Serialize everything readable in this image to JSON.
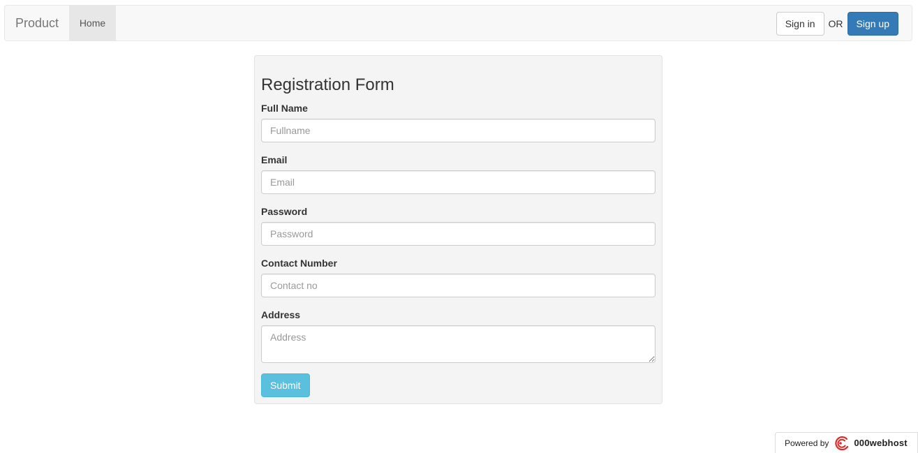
{
  "navbar": {
    "brand": "Product",
    "home_label": "Home",
    "sign_in_label": "Sign in",
    "or_text": "OR",
    "sign_up_label": "Sign up"
  },
  "form": {
    "title": "Registration Form",
    "fields": [
      {
        "label": "Full Name",
        "placeholder": "Fullname",
        "value": ""
      },
      {
        "label": "Email",
        "placeholder": "Email",
        "value": ""
      },
      {
        "label": "Password",
        "placeholder": "Password",
        "value": ""
      },
      {
        "label": "Contact Number",
        "placeholder": "Contact no",
        "value": ""
      },
      {
        "label": "Address",
        "placeholder": "Address",
        "value": ""
      }
    ],
    "submit_label": "Submit"
  },
  "footer": {
    "powered_by": "Powered by",
    "host_name": "000webhost",
    "logo_icon": "000webhost-logo-icon"
  },
  "colors": {
    "navbar_bg": "#f8f8f8",
    "primary": "#337ab7",
    "info": "#5bc0de",
    "panel_bg": "#f4f4f4",
    "logo_red": "#e02a2a"
  }
}
